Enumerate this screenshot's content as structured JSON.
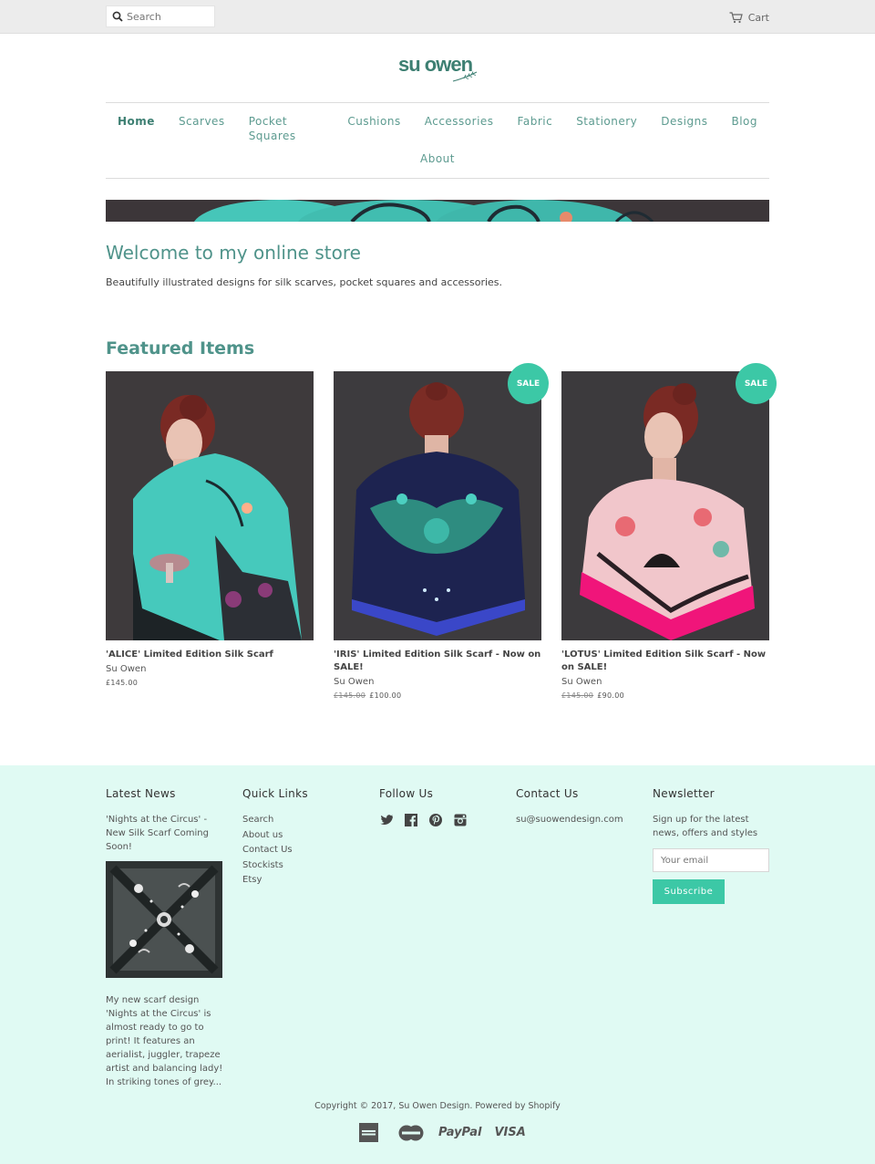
{
  "topbar": {
    "search_placeholder": "Search",
    "cart_label": "Cart"
  },
  "logo": {
    "text": "su owen"
  },
  "nav": {
    "items": [
      {
        "label": "Home",
        "active": true
      },
      {
        "label": "Scarves"
      },
      {
        "label": "Pocket Squares"
      },
      {
        "label": "Cushions"
      },
      {
        "label": "Accessories"
      },
      {
        "label": "Fabric"
      },
      {
        "label": "Stationery"
      },
      {
        "label": "Designs"
      },
      {
        "label": "Blog"
      },
      {
        "label": "About"
      }
    ]
  },
  "welcome": {
    "title": "Welcome to my online store",
    "text": "Beautifully illustrated designs for silk scarves, pocket squares and accessories."
  },
  "featured": {
    "title": "Featured Items",
    "products": [
      {
        "name": "'ALICE' Limited Edition Silk Scarf",
        "vendor": "Su Owen",
        "price": "£145.00",
        "old_price": "",
        "sale": false
      },
      {
        "name": "'IRIS' Limited Edition Silk Scarf - Now on SALE!",
        "vendor": "Su Owen",
        "price": "£100.00",
        "old_price": "£145.00",
        "sale": true,
        "badge": "SALE"
      },
      {
        "name": "'LOTUS' Limited Edition Silk Scarf - Now on SALE!",
        "vendor": "Su Owen",
        "price": "£90.00",
        "old_price": "£145.00",
        "sale": true,
        "badge": "SALE"
      }
    ]
  },
  "footer": {
    "latest_news": {
      "heading": "Latest News",
      "post_title": "'Nights at the Circus' - New Silk Scarf Coming Soon!",
      "excerpt": "My new scarf design 'Nights at the Circus' is almost ready to go to print! It features an aerialist, juggler, trapeze artist and balancing lady! In striking tones of grey..."
    },
    "quick_links": {
      "heading": "Quick Links",
      "items": [
        "Search",
        "About us",
        "Contact Us",
        "Stockists",
        "Etsy"
      ]
    },
    "follow_us": {
      "heading": "Follow Us",
      "icons": [
        "twitter-icon",
        "facebook-icon",
        "pinterest-icon",
        "instagram-icon"
      ]
    },
    "contact": {
      "heading": "Contact Us",
      "email": "su@suowendesign.com"
    },
    "newsletter": {
      "heading": "Newsletter",
      "text": "Sign up for the latest news, offers and styles",
      "email_placeholder": "Your email",
      "button_label": "Subscribe"
    },
    "copyright": "Copyright © 2017, Su Owen Design. Powered by Shopify",
    "payments": [
      "American Express",
      "MasterCard",
      "PayPal",
      "VISA"
    ],
    "paypal_text": "PayPal",
    "visa_text": "VISA"
  },
  "colors": {
    "accent": "#3cc8a6",
    "heading": "#4f938a",
    "footer_bg": "#e0faf3"
  }
}
